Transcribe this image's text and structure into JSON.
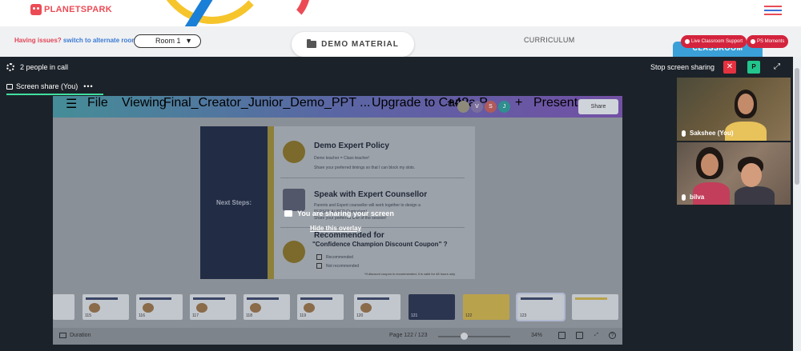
{
  "header": {
    "logo_text": "PLANETSPARK"
  },
  "subbar": {
    "issues_text": "Having issues?",
    "switch_link": "switch to alternate room",
    "room_select_value": "Room 1",
    "demo_material_label": "DEMO MATERIAL",
    "curriculum_label": "CURRICULUM",
    "classroom_tab": "CLASSROOM",
    "live_support_label": "Live Classroom Support",
    "ps_moments_label": "PS Moments"
  },
  "call": {
    "people_count_text": "2 people in call",
    "stop_sharing_label": "Stop screen sharing",
    "close_glyph": "✕",
    "p_button_label": "P",
    "share_tab_label": "Screen share (You)",
    "share_tab_more": "•••",
    "overlay_message": "You are sharing your screen",
    "hide_overlay_label": "Hide this overlay"
  },
  "canva": {
    "file_menu": "File",
    "viewing_mode": "Viewing",
    "doc_title": "Final_Creator_Junior_Demo_PPT ...",
    "upgrade_label": "Upgrade to Canva P...",
    "collab_count": "+42",
    "avatar_v": "V",
    "avatar_s": "S",
    "avatar_j": "J",
    "plus": "+",
    "present_label": "Present",
    "share_label": "Share",
    "slide": {
      "left_title": "Next Steps:",
      "policy_heading": "Demo Expert Policy",
      "policy_sub1": "Demo teacher = Class teacher!",
      "policy_sub2": "Share your preferred timings so that I can block my slots.",
      "counsellor_heading": "Speak with Expert Counsellor",
      "counsellor_sub1": "Parents and Expert counsellor will work together to design a",
      "counsellor_sub2": "PERSONALISED Curriculum!",
      "counsellor_sub3": "Share your preferred time of the session!",
      "recommended_heading": "Recommended for",
      "recommended_sub": "\"Confidence Champion Discount Coupon\" ?",
      "option1": "Recommended",
      "option2": "Not recommended",
      "footnote": "*If discount coupon is recommended, it is valid for 48 hours only"
    },
    "thumb_numbers": [
      "115",
      "116",
      "117",
      "118",
      "119",
      "120",
      "121",
      "122",
      "123"
    ],
    "duration_label": "Duration",
    "page_indicator": "Page 122 / 123",
    "zoom_level": "34%"
  },
  "participants": [
    {
      "name": "Sakshee (You)"
    },
    {
      "name": "bilva"
    }
  ],
  "colors": {
    "brand_red": "#ec4b55",
    "classroom_blue": "#3ba0d8",
    "call_bg": "#1c2229",
    "close_red": "#e53240",
    "p_green": "#22c58b",
    "share_underline": "#3fe0a0"
  }
}
